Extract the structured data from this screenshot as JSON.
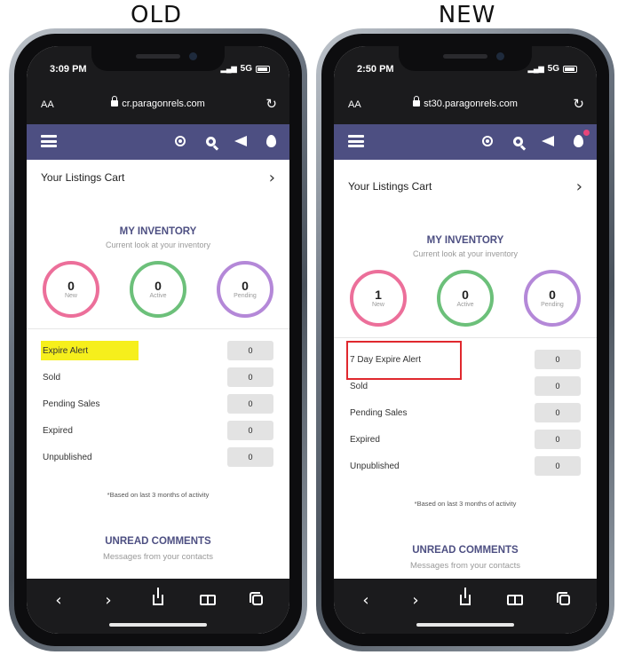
{
  "titles": {
    "old": "OLD",
    "new": "NEW"
  },
  "colors": {
    "nav_bar": "#4d4f82",
    "heading": "#4d4f82",
    "new_ring": "#ec6f9a",
    "active_ring": "#6cc07a",
    "pending_ring": "#b488d8",
    "highlight_yellow": "#f6ef1c",
    "highlight_red": "#e0282e"
  },
  "old": {
    "status": {
      "time": "3:09 PM",
      "signal": "5G"
    },
    "browser": {
      "text_size": "AA",
      "url": "cr.paragonrels.com"
    },
    "nav_icons": [
      "location-pin-icon",
      "search-icon",
      "megaphone-icon",
      "flame-icon"
    ],
    "cart_label": "Your Listings Cart",
    "inventory": {
      "title": "MY INVENTORY",
      "subtitle": "Current look at your inventory",
      "circles": [
        {
          "value": "0",
          "label": "New"
        },
        {
          "value": "0",
          "label": "Active"
        },
        {
          "value": "0",
          "label": "Pending"
        }
      ]
    },
    "stats": [
      {
        "label": "Expire Alert",
        "value": "0"
      },
      {
        "label": "Sold",
        "value": "0"
      },
      {
        "label": "Pending Sales",
        "value": "0"
      },
      {
        "label": "Expired",
        "value": "0"
      },
      {
        "label": "Unpublished",
        "value": "0"
      }
    ],
    "note": "*Based on last 3 months of activity",
    "unread": {
      "title": "UNREAD COMMENTS",
      "subtitle": "Messages from your contacts"
    }
  },
  "new": {
    "status": {
      "time": "2:50 PM",
      "signal": "5G"
    },
    "browser": {
      "text_size": "AA",
      "url": "st30.paragonrels.com"
    },
    "nav_icons": [
      "location-pin-icon",
      "search-icon",
      "megaphone-icon",
      "flame-icon"
    ],
    "cart_label": "Your Listings Cart",
    "inventory": {
      "title": "MY INVENTORY",
      "subtitle": "Current look at your inventory",
      "circles": [
        {
          "value": "1",
          "label": "New"
        },
        {
          "value": "0",
          "label": "Active"
        },
        {
          "value": "0",
          "label": "Pending"
        }
      ]
    },
    "stats": [
      {
        "label": "7 Day Expire Alert",
        "value": "0"
      },
      {
        "label": "Sold",
        "value": "0"
      },
      {
        "label": "Pending Sales",
        "value": "0"
      },
      {
        "label": "Expired",
        "value": "0"
      },
      {
        "label": "Unpublished",
        "value": "0"
      }
    ],
    "note": "*Based on last 3 months of activity",
    "unread": {
      "title": "UNREAD COMMENTS",
      "subtitle": "Messages from your contacts"
    }
  }
}
